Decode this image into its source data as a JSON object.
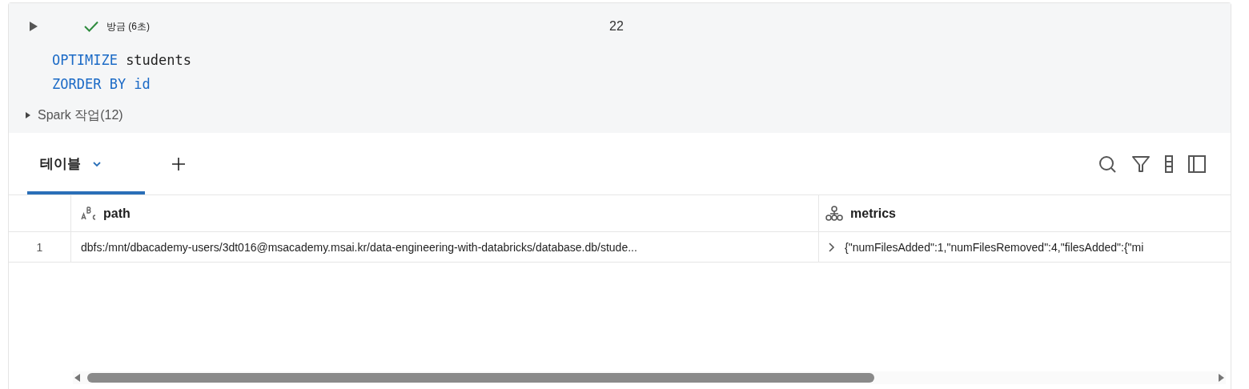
{
  "cell": {
    "status": {
      "succeeded": true,
      "text": "방금 (6초)"
    },
    "count": "22",
    "code": [
      [
        {
          "kind": "keyword",
          "text": "OPTIMIZE"
        },
        {
          "kind": "plain",
          "text": " students"
        }
      ],
      [
        {
          "kind": "keyword",
          "text": "ZORDER BY id"
        }
      ]
    ],
    "spark_jobs": {
      "label": "Spark 작업(12)",
      "expanded": false
    }
  },
  "result": {
    "tabs": [
      {
        "label": "테이블",
        "selected": true
      }
    ],
    "table": {
      "columns": [
        {
          "name": "path",
          "kind": "string"
        },
        {
          "name": "metrics",
          "kind": "struct"
        }
      ],
      "rows": [
        {
          "index": "1",
          "cells": [
            {
              "text": "dbfs:/mnt/dbacademy-users/3dt016@msacademy.msai.kr/data-engineering-with-databricks/database.db/stude..."
            },
            {
              "text": "{\"numFilesAdded\":1,\"numFilesRemoved\":4,\"filesAdded\":{\"mi",
              "expanded": false
            }
          ]
        }
      ]
    }
  }
}
